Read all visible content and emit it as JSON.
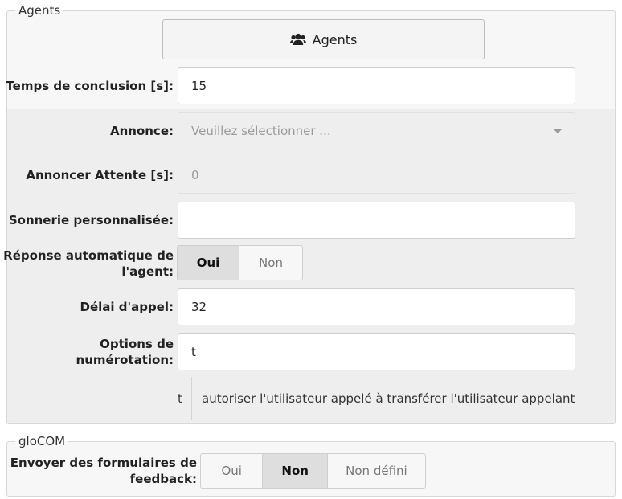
{
  "agents_section": {
    "legend": "Agents",
    "agents_button_label": "Agents",
    "fields": {
      "conclusion_time": {
        "label": "Temps de conclusion [s]:",
        "value": "15"
      },
      "announcement": {
        "label": "Annonce:",
        "placeholder": "Veuillez sélectionner ..."
      },
      "announce_wait": {
        "label": "Annoncer Attente [s]:",
        "value": "0"
      },
      "custom_ringtone": {
        "label": "Sonnerie personnalisée:",
        "value": ""
      },
      "auto_answer": {
        "label_line1": "Réponse automatique de",
        "label_line2": "l'agent:",
        "options": [
          "Oui",
          "Non"
        ],
        "selected": "Oui"
      },
      "call_delay": {
        "label": "Délai d'appel:",
        "value": "32"
      },
      "dial_options": {
        "label": "Options de numérotation:",
        "value": "t"
      }
    },
    "dial_option_hint": {
      "key": "t",
      "description": "autoriser l'utilisateur appelé à transférer l'utilisateur appelant"
    }
  },
  "glocom_section": {
    "legend": "gloCOM",
    "feedback_forms": {
      "label_line1": "Envoyer des formulaires de",
      "label_line2": "feedback:",
      "options": [
        "Oui",
        "Non",
        "Non défini"
      ],
      "selected": "Non"
    }
  },
  "icons": {
    "agents_button": "users-icon",
    "select_caret": "chevron-down-icon"
  },
  "colors": {
    "panel_bg": "#f7f7f7",
    "band_bg": "#eeeeee",
    "active_segment": "#dedede"
  }
}
